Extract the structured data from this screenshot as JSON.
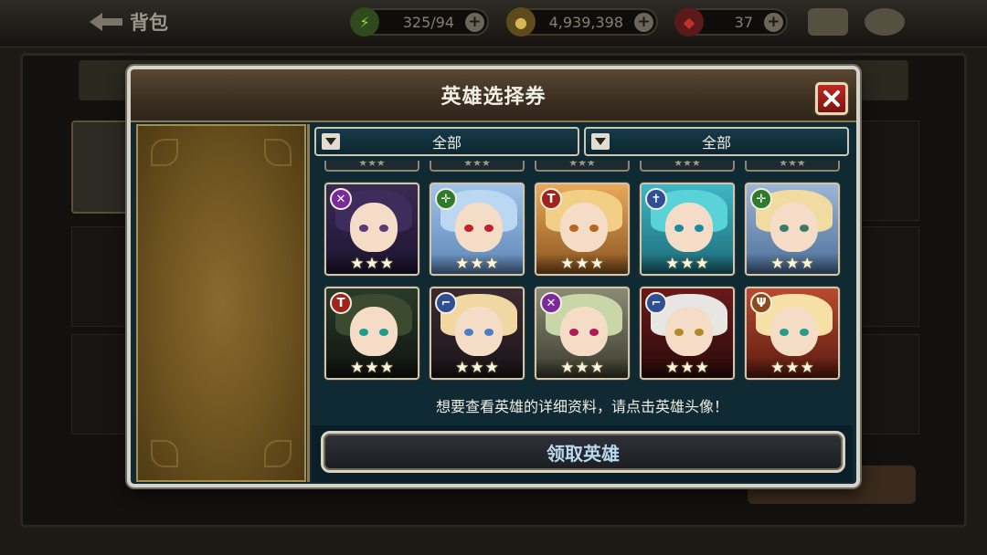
{
  "topbar": {
    "back_label": "背包",
    "stamina": "325/94",
    "gold": "4,939,398",
    "gems": "37",
    "plus": "+"
  },
  "dialog": {
    "title": "英雄选择券",
    "filters": [
      "全部",
      "全部"
    ],
    "hint": "想要查看英雄的详细资料，请点击英雄头像！",
    "claim_button": "领取英雄"
  },
  "heroes": [
    {
      "role": "sword-icon",
      "role_glyph": "✕",
      "role_color": "#7a2a9a",
      "stars": 3
    },
    {
      "role": "bow-icon",
      "role_glyph": "✛",
      "role_color": "#2f7a2c",
      "stars": 3
    },
    {
      "role": "hammer-icon",
      "role_glyph": "T",
      "role_color": "#a0231c",
      "stars": 3
    },
    {
      "role": "staff-icon",
      "role_glyph": "✝",
      "role_color": "#2e4f93",
      "stars": 3
    },
    {
      "role": "bow-icon",
      "role_glyph": "✛",
      "role_color": "#2f7a2c",
      "stars": 3
    },
    {
      "role": "hammer-icon",
      "role_glyph": "T",
      "role_color": "#a0231c",
      "stars": 3
    },
    {
      "role": "gun-icon",
      "role_glyph": "⌐",
      "role_color": "#2e4f93",
      "stars": 3
    },
    {
      "role": "sword-icon",
      "role_glyph": "✕",
      "role_color": "#7a2a9a",
      "stars": 3
    },
    {
      "role": "gun-icon",
      "role_glyph": "⌐",
      "role_color": "#2e4f93",
      "stars": 3
    },
    {
      "role": "axe-icon",
      "role_glyph": "Ψ",
      "role_color": "#8a4a1c",
      "stars": 3
    }
  ],
  "colors": {
    "panel": "#0f2a33",
    "frame": "#d6d3c9",
    "close": "#c3261e",
    "claim_text": "#b8d9ee"
  }
}
